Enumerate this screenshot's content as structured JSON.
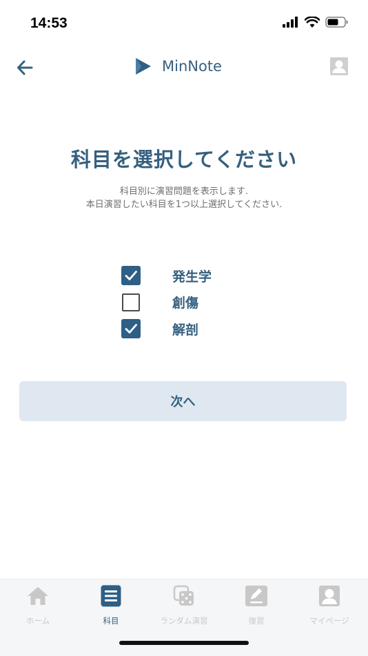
{
  "status_bar": {
    "time": "14:53",
    "icons": [
      "signal-icon",
      "wifi-icon",
      "battery-icon"
    ]
  },
  "header": {
    "back_icon": "arrow-left-icon",
    "brand_icon": "play-logo-icon",
    "brand_name": "MinNote",
    "profile_icon": "user-icon"
  },
  "main": {
    "title": "科目を選択してください",
    "description_line1": "科目別に演習問題を表示します.",
    "description_line2": "本日演習したい科目を1つ以上選択してください.",
    "subjects": [
      {
        "label": "発生学",
        "checked": true
      },
      {
        "label": "創傷",
        "checked": false
      },
      {
        "label": "解剖",
        "checked": true
      }
    ],
    "next_button_label": "次へ"
  },
  "tab_bar": {
    "tabs": [
      {
        "label": "ホーム",
        "icon": "home-icon",
        "active": false
      },
      {
        "label": "科目",
        "icon": "list-icon",
        "active": true
      },
      {
        "label": "ランダム演習",
        "icon": "dice-icon",
        "active": false
      },
      {
        "label": "復習",
        "icon": "edit-icon",
        "active": false
      },
      {
        "label": "マイページ",
        "icon": "user-icon",
        "active": false
      }
    ]
  },
  "colors": {
    "primary": "#35607f",
    "checkbox_fill": "#2e5f86",
    "button_bg": "#dfe8f1",
    "inactive_tab": "#c8c8c8"
  }
}
